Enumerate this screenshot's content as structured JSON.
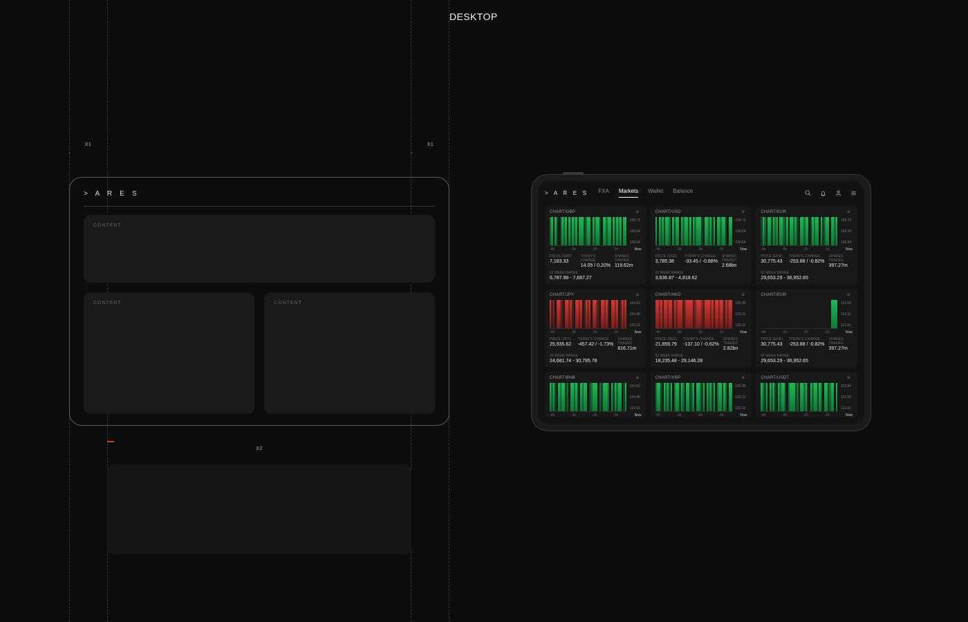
{
  "labels": {
    "desktop": "DESKTOP",
    "x1": "X1",
    "x2": "X2",
    "content": "CONTENT",
    "wire_logo": "> A R E S"
  },
  "app": {
    "logo": "> A R E S",
    "tabs": [
      "FXA",
      "Markets",
      "Wallet",
      "Balance"
    ],
    "active_tab": 1,
    "xaxis": [
      "-4h",
      "-3h",
      "-2h",
      "-1h",
      "Now"
    ]
  },
  "stat_labels": {
    "price_prefix": "PRICE",
    "today": "TODAY'S CHANGE",
    "shares": "SHARES TRADED",
    "range": "52 WEEK RANGE"
  },
  "cards": [
    {
      "title": "CHART/GBP",
      "ccy": "GBP",
      "price": "7,183.33",
      "change": "14.05 / 0.20%",
      "dir": "up",
      "shares": "119.62m",
      "range": "6,787.98 - 7,687.27",
      "y": [
        "108.72",
        "108.54",
        "108.54"
      ]
    },
    {
      "title": "CHART/USD",
      "ccy": "USD",
      "price": "3,785.38",
      "change": "-33.45 / -0.88%",
      "dir": "dn",
      "shares": "2.68bn",
      "range": "3,636.87 - 4,818.62",
      "y": [
        "108.72",
        "108.54",
        "108.54"
      ]
    },
    {
      "title": "CHART/EUR",
      "ccy": "EUR",
      "price": "30,775.43",
      "change": "-253.88 / -0.82%",
      "dir": "dn",
      "shares": "397.27m",
      "range": "29,653.29 - 36,952.65",
      "y": [
        "108.72",
        "108.54",
        "108.54"
      ]
    },
    {
      "title": "CHART/JPY",
      "ccy": "JPY",
      "price": "25,935.62",
      "change": "-457.42 / -1.73%",
      "dir": "dn",
      "shares": "816.71m",
      "range": "24,681.74 - 30,795.78",
      "y": [
        "134.62",
        "134.46",
        "123.12"
      ]
    },
    {
      "title": "CHART/HKD",
      "ccy": "HKD",
      "price": "21,859.79",
      "change": "-137.10 / -0.62%",
      "dir": "dn",
      "shares": "2.82bn",
      "range": "18,235.48 - 29,146.28",
      "y": [
        "102.45",
        "102.31",
        "102.11"
      ]
    },
    {
      "title": "CHART/EUR",
      "ccy": "EUR",
      "price": "30,775.43",
      "change": "-253.88 / -0.82%",
      "dir": "dn",
      "shares": "397.27m",
      "range": "29,653.29 - 36,952.65",
      "y": [
        "116.64",
        "114.31",
        "112.61"
      ]
    },
    {
      "title": "CHART/BNB",
      "ccy": "BNB",
      "price": "",
      "change": "",
      "dir": "up",
      "shares": "",
      "range": "",
      "y": [
        "134.62",
        "134.46",
        "122.61"
      ]
    },
    {
      "title": "CHART/XRP",
      "ccy": "XRP",
      "price": "",
      "change": "",
      "dir": "up",
      "shares": "",
      "range": "",
      "y": [
        "102.45",
        "102.31",
        "102.11"
      ]
    },
    {
      "title": "CHART/USDT",
      "ccy": "USDT",
      "price": "",
      "change": "",
      "dir": "up",
      "shares": "",
      "range": "",
      "y": [
        "115.84",
        "115.64",
        "112.61"
      ]
    }
  ],
  "chart_data": [
    {
      "type": "bar",
      "title": "CHART/GBP",
      "series_color": "green",
      "x_ticks": [
        "-4h",
        "-3h",
        "-2h",
        "-1h",
        "Now"
      ],
      "y_ticks": [
        108.72,
        108.54,
        108.54
      ],
      "bars": [
        "1m",
        "1",
        "0",
        "1",
        "1d",
        "0",
        "1d",
        "1",
        "1m",
        "1",
        "0",
        "1",
        "1d",
        "1",
        "1m",
        "1",
        "0",
        "1",
        "1",
        "1",
        "1d",
        "1m",
        "1",
        "1",
        "0",
        "1",
        "1m",
        "1",
        "1",
        "1d",
        "0",
        "1",
        "1",
        "1m",
        "1",
        "1",
        "0",
        "1",
        "1d",
        "1",
        "1m",
        "1",
        "0",
        "1",
        "1"
      ]
    },
    {
      "type": "bar",
      "title": "CHART/USD",
      "series_color": "green",
      "x_ticks": [
        "-4h",
        "-3h",
        "-2h",
        "-1h",
        "Now"
      ],
      "y_ticks": [
        108.72,
        108.54,
        108.54
      ],
      "bars": [
        "1",
        "0",
        "1",
        "1m",
        "1",
        "1d",
        "1",
        "1",
        "1m",
        "0",
        "1",
        "1d",
        "1",
        "1",
        "0",
        "1",
        "1m",
        "1",
        "1",
        "1d",
        "1",
        "0",
        "1",
        "1m",
        "1",
        "1",
        "1",
        "1d",
        "0",
        "1",
        "1",
        "1m",
        "1",
        "1d",
        "1",
        "0",
        "1",
        "1",
        "1m",
        "1",
        "1",
        "1d",
        "0",
        "1",
        "1"
      ]
    },
    {
      "type": "bar",
      "title": "CHART/EUR",
      "series_color": "green",
      "x_ticks": [
        "-4h",
        "-3h",
        "-2h",
        "-1h",
        "Now"
      ],
      "y_ticks": [
        108.72,
        108.54,
        108.54
      ],
      "bars": [
        "1d",
        "1",
        "1m",
        "0",
        "1",
        "1",
        "1d",
        "1",
        "1m",
        "1",
        "0",
        "1",
        "1",
        "1m",
        "1d",
        "1",
        "0",
        "1",
        "1",
        "1m",
        "1",
        "1d",
        "0",
        "1",
        "1",
        "1m",
        "1",
        "1",
        "0",
        "1d",
        "1",
        "1m",
        "1",
        "1",
        "0",
        "1",
        "1d",
        "1m",
        "1",
        "1",
        "0",
        "1",
        "1",
        "1m",
        "1"
      ]
    },
    {
      "type": "bar",
      "title": "CHART/JPY",
      "series_color": "red",
      "x_ticks": [
        "-4h",
        "-3h",
        "-2h",
        "-1h",
        "Now"
      ],
      "y_ticks": [
        134.62,
        134.46,
        123.12
      ],
      "bars": [
        "1",
        "1d",
        "1m",
        "0",
        "1",
        "1",
        "1m",
        "1d",
        "0",
        "1",
        "1",
        "1m",
        "1",
        "1d",
        "0",
        "1",
        "1",
        "1m",
        "1",
        "0",
        "1d",
        "1",
        "1m",
        "1",
        "0",
        "1",
        "1",
        "1m",
        "1d",
        "0",
        "1",
        "1",
        "1m",
        "1",
        "1d",
        "0",
        "1",
        "1",
        "1m",
        "1",
        "0",
        "1d",
        "1",
        "1m",
        "1"
      ]
    },
    {
      "type": "bar",
      "title": "CHART/HKD",
      "series_color": "red",
      "x_ticks": [
        "-4h",
        "-3h",
        "-2h",
        "-1h",
        "Now"
      ],
      "y_ticks": [
        102.45,
        102.31,
        102.11
      ],
      "bars": [
        "1",
        "1",
        "1m",
        "1",
        "1d",
        "1",
        "1",
        "1m",
        "1",
        "1",
        "1d",
        "1",
        "1m",
        "1",
        "1",
        "1",
        "1d",
        "1m",
        "1",
        "1",
        "1",
        "1",
        "1d",
        "1m",
        "1",
        "1",
        "1",
        "1m",
        "1d",
        "1",
        "1",
        "1",
        "1m",
        "1",
        "1d",
        "1",
        "1",
        "1m",
        "1",
        "1",
        "1d",
        "1",
        "1m",
        "1",
        "1"
      ]
    },
    {
      "type": "bar",
      "title": "CHART/EUR",
      "series_color": "green",
      "x_ticks": [
        "-4h",
        "-3h",
        "-2h",
        "-1h",
        "Now"
      ],
      "y_ticks": [
        116.64,
        114.31,
        112.61
      ],
      "bars": [
        "0",
        "0",
        "0",
        "0",
        "0",
        "0",
        "0",
        "0",
        "0",
        "0",
        "0",
        "0",
        "0",
        "0",
        "0",
        "0",
        "0",
        "0",
        "0",
        "0",
        "0",
        "0",
        "0",
        "0",
        "0",
        "0",
        "0",
        "0",
        "0",
        "0",
        "0",
        "0",
        "0",
        "0",
        "0",
        "0",
        "0",
        "0",
        "0",
        "0",
        "0",
        "1",
        "1",
        "1",
        "1"
      ]
    },
    {
      "type": "bar",
      "title": "CHART/BNB",
      "series_color": "green",
      "x_ticks": [
        "-4h",
        "-3h",
        "-2h",
        "-1h",
        "Now"
      ],
      "y_ticks": [
        134.62,
        134.46,
        122.61
      ],
      "bars": [
        "1",
        "1m",
        "1",
        "1d",
        "0",
        "1",
        "1m",
        "1",
        "1",
        "1d",
        "1m",
        "0",
        "1",
        "1",
        "1m",
        "1",
        "1d",
        "0",
        "1",
        "1m",
        "1",
        "1",
        "0",
        "1d",
        "1m",
        "1",
        "1",
        "1",
        "0",
        "1m",
        "1d",
        "1",
        "1",
        "1",
        "1m",
        "0",
        "1",
        "1d",
        "1",
        "1m",
        "1",
        "1",
        "0",
        "1d",
        "1"
      ]
    },
    {
      "type": "bar",
      "title": "CHART/XRP",
      "series_color": "green",
      "x_ticks": [
        "-4h",
        "-3h",
        "-2h",
        "-1h",
        "Now"
      ],
      "y_ticks": [
        102.45,
        102.31,
        102.11
      ],
      "bars": [
        "1m",
        "1",
        "1",
        "1d",
        "0",
        "1",
        "1m",
        "1",
        "1d",
        "1",
        "0",
        "1m",
        "1",
        "1",
        "1d",
        "1",
        "1m",
        "0",
        "1",
        "1",
        "1d",
        "1m",
        "1",
        "0",
        "1",
        "1",
        "1m",
        "1d",
        "1",
        "0",
        "1",
        "1m",
        "1",
        "1d",
        "1",
        "0",
        "1m",
        "1",
        "1",
        "1d",
        "1",
        "1m",
        "0",
        "1",
        "1"
      ]
    },
    {
      "type": "bar",
      "title": "CHART/USDT",
      "series_color": "green",
      "x_ticks": [
        "-4h",
        "-3h",
        "-2h",
        "-1h",
        "Now"
      ],
      "y_ticks": [
        115.84,
        115.64,
        112.61
      ],
      "bars": [
        "1",
        "1m",
        "1d",
        "1",
        "0",
        "1",
        "1m",
        "1",
        "1d",
        "0",
        "1",
        "1m",
        "1",
        "1",
        "1d",
        "0",
        "1m",
        "1",
        "1",
        "1",
        "1d",
        "1m",
        "0",
        "1",
        "1",
        "1m",
        "1",
        "1d",
        "0",
        "1",
        "1m",
        "1",
        "1",
        "1d",
        "1",
        "1m",
        "0",
        "1",
        "1",
        "1d",
        "1m",
        "1",
        "1",
        "0",
        "1"
      ]
    }
  ]
}
